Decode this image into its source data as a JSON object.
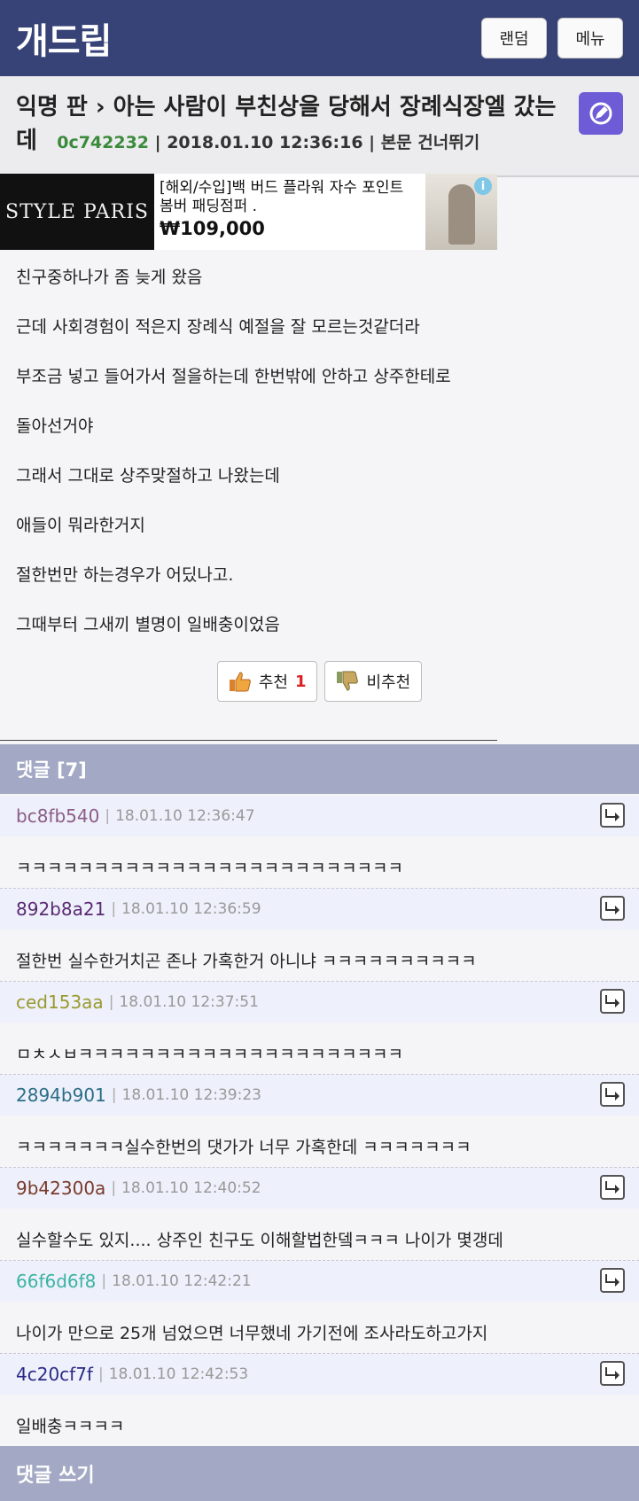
{
  "header": {
    "logo": "개드립",
    "random_label": "랜덤",
    "menu_label": "메뉴"
  },
  "post": {
    "breadcrumb_board": "익명 판",
    "breadcrumb_sep": "›",
    "title": "아는 사람이 부친상을 당해서 장례식장엘 갔는데",
    "author_id": "0c742232",
    "datetime": "2018.01.10 12:36:16",
    "skip_label": "본문 건너뛰기",
    "paragraphs": [
      "친구중하나가 좀 늦게 왔음",
      "근데 사회경험이 적은지 장례식 예절을 잘 모르는것같더라",
      "부조금 넣고 들어가서 절을하는데 한번밖에 안하고 상주한테로",
      "돌아선거야",
      "그래서 그대로 상주맞절하고 나왔는데",
      "애들이 뭐라한거지",
      "절한번만 하는경우가 어딨나고.",
      "그때부터 그새끼 별명이 일배충이었음"
    ],
    "upvote_label": "추천",
    "upvote_count": "1",
    "downvote_label": "비추천"
  },
  "ad": {
    "brand": "STYLE PARIS",
    "title": "[해외/수입]백 버드 플라워 자수 포인트 봄버 패딩점퍼 .",
    "price": "₩109,000",
    "info_icon": "i"
  },
  "comments": {
    "header": "댓글 [7]",
    "items": [
      {
        "user": "bc8fb540",
        "color": "#8a5d86",
        "time": "18.01.10 12:36:47",
        "text": "ㅋㅋㅋㅋㅋㅋㅋㅋㅋㅋㅋㅋㅋㅋㅋㅋㅋㅋㅋㅋㅋㅋㅋㅋㅋ"
      },
      {
        "user": "892b8a21",
        "color": "#5a2a73",
        "time": "18.01.10 12:36:59",
        "text": "절한번 실수한거치곤 존나 가혹한거 아니냐 ㅋㅋㅋㅋㅋㅋㅋㅋㅋㅋ"
      },
      {
        "user": "ced153aa",
        "color": "#9a9a30",
        "time": "18.01.10 12:37:51",
        "text": "ㅁㅊㅅㅂㅋㅋㅋㅋㅋㅋㅋㅋㅋㅋㅋㅋㅋㅋㅋㅋㅋㅋㅋㅋㅋ"
      },
      {
        "user": "2894b901",
        "color": "#2a6e86",
        "time": "18.01.10 12:39:23",
        "text": "ㅋㅋㅋㅋㅋㅋㅋ실수한번의 댓가가 너무 가혹한데 ㅋㅋㅋㅋㅋㅋㅋ"
      },
      {
        "user": "9b42300a",
        "color": "#7a3a2a",
        "time": "18.01.10 12:40:52",
        "text": "실수할수도 있지.... 상주인 친구도 이해할법한뎈ㅋㅋㅋ 나이가 몇갱데"
      },
      {
        "user": "66f6d6f8",
        "color": "#3bb3a3",
        "time": "18.01.10 12:42:21",
        "text": "나이가 만으로 25개 넘었으면 너무했네 가기전에 조사라도하고가지"
      },
      {
        "user": "4c20cf7f",
        "color": "#2a2a86",
        "time": "18.01.10 12:42:53",
        "text": "일배충ㅋㅋㅋㅋ"
      }
    ]
  },
  "footer": {
    "write_comment_label": "댓글 쓰기"
  }
}
